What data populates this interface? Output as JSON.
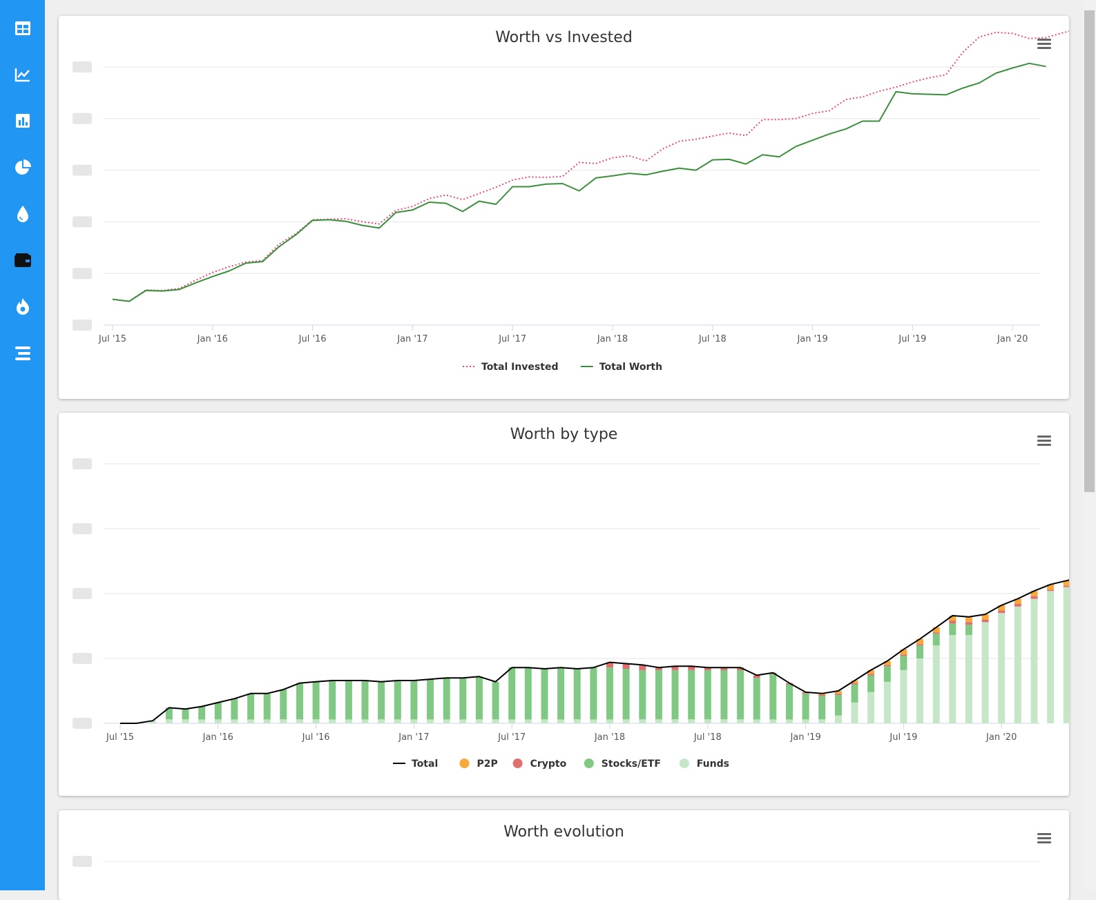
{
  "sidebar": {
    "items": [
      {
        "icon": "table-icon"
      },
      {
        "icon": "line-chart-icon"
      },
      {
        "icon": "bar-chart-icon"
      },
      {
        "icon": "pie-chart-icon"
      },
      {
        "icon": "water-drop-icon"
      },
      {
        "icon": "wallet-icon"
      },
      {
        "icon": "flame-icon"
      },
      {
        "icon": "stacked-bars-icon"
      }
    ],
    "colors": {
      "background": "#2196f3",
      "icon": "#ffffff",
      "active_icon": "#111111"
    }
  },
  "charts": [
    {
      "title": "Worth vs Invested"
    },
    {
      "title": "Worth by type"
    },
    {
      "title": "Worth evolution"
    }
  ],
  "chart_data": [
    {
      "type": "line",
      "title": "Worth vs Invested",
      "x_tick_labels": [
        "Jul '15",
        "Jan '16",
        "Jul '16",
        "Jan '17",
        "Jul '17",
        "Jan '18",
        "Jul '18",
        "Jan '19",
        "Jul '19",
        "Jan '20"
      ],
      "x_range": [
        "2015-07",
        "2020-02"
      ],
      "y_tick_labels_legible": false,
      "grid": true,
      "legend_position": "bottom",
      "series": [
        {
          "name": "Total Invested",
          "color": "#e5487a",
          "style": "dotted",
          "values": [
            5.0,
            4.6,
            6.8,
            6.7,
            7.1,
            8.7,
            10.2,
            11.3,
            12.2,
            12.5,
            15.7,
            17.7,
            20.4,
            20.5,
            20.6,
            20.0,
            19.6,
            22.2,
            23.0,
            24.5,
            25.2,
            24.3,
            25.5,
            26.7,
            28.1,
            28.7,
            28.6,
            28.8,
            31.5,
            31.3,
            32.4,
            32.8,
            31.8,
            34.1,
            35.6,
            36.0,
            36.6,
            37.2,
            36.7,
            39.8,
            39.8,
            40.0,
            41.0,
            41.5,
            43.7,
            44.2,
            45.3,
            46.1,
            47.1,
            47.9,
            48.5,
            52.8,
            55.8,
            56.7,
            56.5,
            55.5,
            55.7,
            56.6,
            57.4,
            58.9,
            60.0,
            60.7,
            61.5,
            60.4
          ]
        },
        {
          "name": "Total Worth",
          "color": "#3a8f3a",
          "style": "solid",
          "values": [
            5.0,
            4.6,
            6.7,
            6.6,
            6.9,
            8.2,
            9.4,
            10.5,
            12.0,
            12.3,
            15.2,
            17.5,
            20.3,
            20.4,
            20.1,
            19.3,
            18.8,
            21.8,
            22.3,
            23.8,
            23.6,
            22.0,
            24.0,
            23.4,
            26.8,
            26.8,
            27.3,
            27.4,
            26.0,
            28.5,
            28.9,
            29.4,
            29.1,
            29.8,
            30.4,
            30.0,
            32.0,
            32.1,
            31.2,
            33.0,
            32.6,
            34.6,
            35.8,
            37.0,
            38.0,
            39.5,
            39.5,
            45.2,
            44.8,
            44.7,
            44.6,
            45.9,
            46.9,
            48.8,
            49.8,
            50.7,
            50.1
          ]
        }
      ]
    },
    {
      "type": "bar",
      "stacked": true,
      "title": "Worth by type",
      "x_tick_labels": [
        "Jul '15",
        "Jan '16",
        "Jul '16",
        "Jan '17",
        "Jul '17",
        "Jan '18",
        "Jul '18",
        "Jan '19",
        "Jul '19",
        "Jan '20"
      ],
      "y_tick_labels_legible": false,
      "grid": true,
      "legend_position": "bottom",
      "series": [
        {
          "name": "Total",
          "color": "#000000",
          "type": "line"
        },
        {
          "name": "P2P",
          "color": "#f7a93a"
        },
        {
          "name": "Crypto",
          "color": "#e07070"
        },
        {
          "name": "Stocks/ETF",
          "color": "#80c883"
        },
        {
          "name": "Funds",
          "color": "#c6e6c8"
        }
      ],
      "funds": [
        0.0,
        0.0,
        0.2,
        0.3,
        0.3,
        0.3,
        0.3,
        0.3,
        0.3,
        0.3,
        0.3,
        0.3,
        0.3,
        0.3,
        0.3,
        0.3,
        0.3,
        0.3,
        0.3,
        0.3,
        0.3,
        0.3,
        0.3,
        0.3,
        0.3,
        0.3,
        0.3,
        0.3,
        0.3,
        0.3,
        0.3,
        0.3,
        0.3,
        0.3,
        0.3,
        0.3,
        0.3,
        0.3,
        0.3,
        0.3,
        0.3,
        0.3,
        0.3,
        0.3,
        0.6,
        1.6,
        2.4,
        3.2,
        4.1,
        5.0,
        6.0,
        6.8,
        6.8,
        7.8,
        8.5,
        9.0,
        9.6,
        10.2,
        10.5,
        10.8,
        11.2,
        11.5
      ],
      "stocks": [
        0.0,
        0.0,
        0.0,
        0.9,
        0.8,
        1.0,
        1.3,
        1.6,
        2.0,
        2.0,
        2.3,
        2.8,
        2.9,
        3.0,
        3.0,
        3.0,
        2.9,
        3.0,
        3.0,
        3.1,
        3.2,
        3.2,
        3.3,
        2.9,
        4.0,
        4.0,
        3.9,
        4.0,
        3.9,
        4.0,
        4.0,
        3.9,
        3.8,
        3.8,
        3.8,
        3.8,
        3.8,
        3.8,
        3.8,
        3.2,
        3.5,
        2.7,
        2.0,
        1.8,
        1.6,
        1.4,
        1.3,
        1.2,
        1.1,
        1.0,
        0.9,
        0.9,
        0.8,
        0.0,
        0.0,
        0.0,
        0.0,
        0.0,
        0.0,
        0.0,
        0.0,
        0.0
      ],
      "crypto": [
        0.0,
        0.0,
        0.0,
        0.0,
        0.0,
        0.0,
        0.0,
        0.0,
        0.0,
        0.0,
        0.0,
        0.0,
        0.0,
        0.0,
        0.0,
        0.0,
        0.0,
        0.0,
        0.0,
        0.0,
        0.0,
        0.0,
        0.0,
        0.0,
        0.0,
        0.0,
        0.0,
        0.0,
        0.0,
        0.0,
        0.4,
        0.4,
        0.4,
        0.2,
        0.3,
        0.3,
        0.2,
        0.2,
        0.2,
        0.2,
        0.1,
        0.1,
        0.1,
        0.1,
        0.1,
        0.1,
        0.1,
        0.1,
        0.1,
        0.1,
        0.1,
        0.2,
        0.2,
        0.2,
        0.2,
        0.2,
        0.2,
        0.1,
        0.1,
        0.1,
        0.1,
        0.1
      ],
      "p2p": [
        0.0,
        0.0,
        0.0,
        0.0,
        0.0,
        0.0,
        0.0,
        0.0,
        0.0,
        0.0,
        0.0,
        0.0,
        0.0,
        0.0,
        0.0,
        0.0,
        0.0,
        0.0,
        0.0,
        0.0,
        0.0,
        0.0,
        0.0,
        0.0,
        0.0,
        0.0,
        0.0,
        0.0,
        0.0,
        0.0,
        0.0,
        0.0,
        0.0,
        0.0,
        0.0,
        0.0,
        0.0,
        0.0,
        0.0,
        0.0,
        0.0,
        0.0,
        0.0,
        0.1,
        0.2,
        0.2,
        0.3,
        0.3,
        0.4,
        0.4,
        0.4,
        0.4,
        0.4,
        0.4,
        0.4,
        0.4,
        0.4,
        0.4,
        0.4,
        0.4,
        0.4,
        0.4
      ]
    },
    {
      "type": "line",
      "title": "Worth evolution"
    }
  ]
}
